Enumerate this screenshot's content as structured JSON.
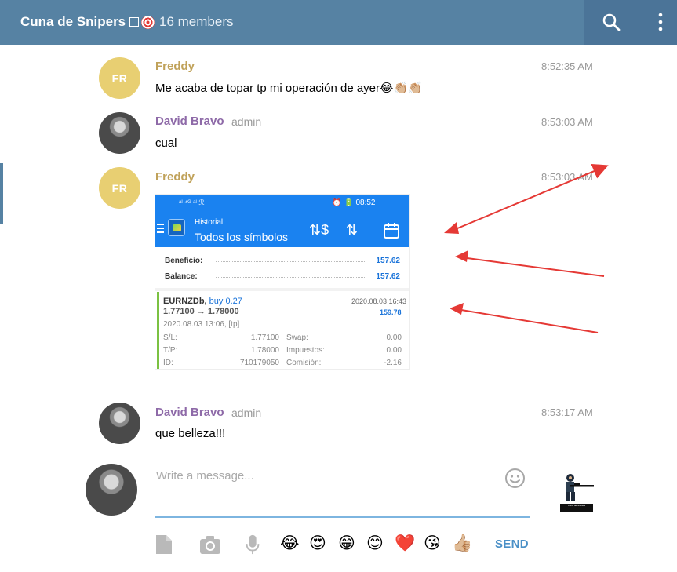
{
  "header": {
    "chat_title": "Cuna de Snipers",
    "members": "16 members"
  },
  "messages": [
    {
      "initials": "FR",
      "sender": "Freddy",
      "time": "8:52:35 AM",
      "text": "Me acaba de topar tp mi operación de ayer",
      "emojis": "😂👏🏼👏🏼"
    },
    {
      "sender": "David Bravo",
      "role": "admin",
      "time": "8:53:03 AM",
      "text": "cual"
    },
    {
      "initials": "FR",
      "sender": "Freddy",
      "time": "8:53:03 AM"
    },
    {
      "sender": "David Bravo",
      "role": "admin",
      "time": "8:53:17 AM",
      "text": "que belleza!!!"
    }
  ],
  "screenshot": {
    "status_left": "ᵃˡ ⁴ᴳ ᵃˡ ℛ",
    "status_right": "⏰ 🔋 08:52",
    "section": "Historial",
    "subtitle": "Todos los símbolos",
    "beneficio_label": "Beneficio:",
    "beneficio_value": "157.62",
    "balance_label": "Balance:",
    "balance_value": "157.62",
    "symbol": "EURNZDb,",
    "side": "buy 0.27",
    "close_date": "2020.08.03 16:43",
    "price_range": "1.77100 → 1.78000",
    "profit": "159.78",
    "open_date": "2020.08.03 13:06, [tp]",
    "sl_label": "S/L:",
    "sl_value": "1.77100",
    "swap_label": "Swap:",
    "swap_value": "0.00",
    "tp_label": "T/P:",
    "tp_value": "1.78000",
    "taxes_label": "Impuestos:",
    "taxes_value": "0.00",
    "id_label": "ID:",
    "id_value": "710179050",
    "commission_label": "Comisión:",
    "commission_value": "-2.16"
  },
  "composer": {
    "placeholder": "Write a message...",
    "send_label": "SEND",
    "sticker_caption": "Cuna de Snipers"
  },
  "quick_emojis": [
    "😂",
    "😍",
    "😁",
    "😊",
    "❤️",
    "😘",
    "👍🏼"
  ],
  "colors": {
    "header": "#5682a3",
    "freddy": "#c0a25a",
    "david": "#8e6aa8",
    "send": "#4a90c7",
    "annotation_arrow": "#e53935"
  }
}
